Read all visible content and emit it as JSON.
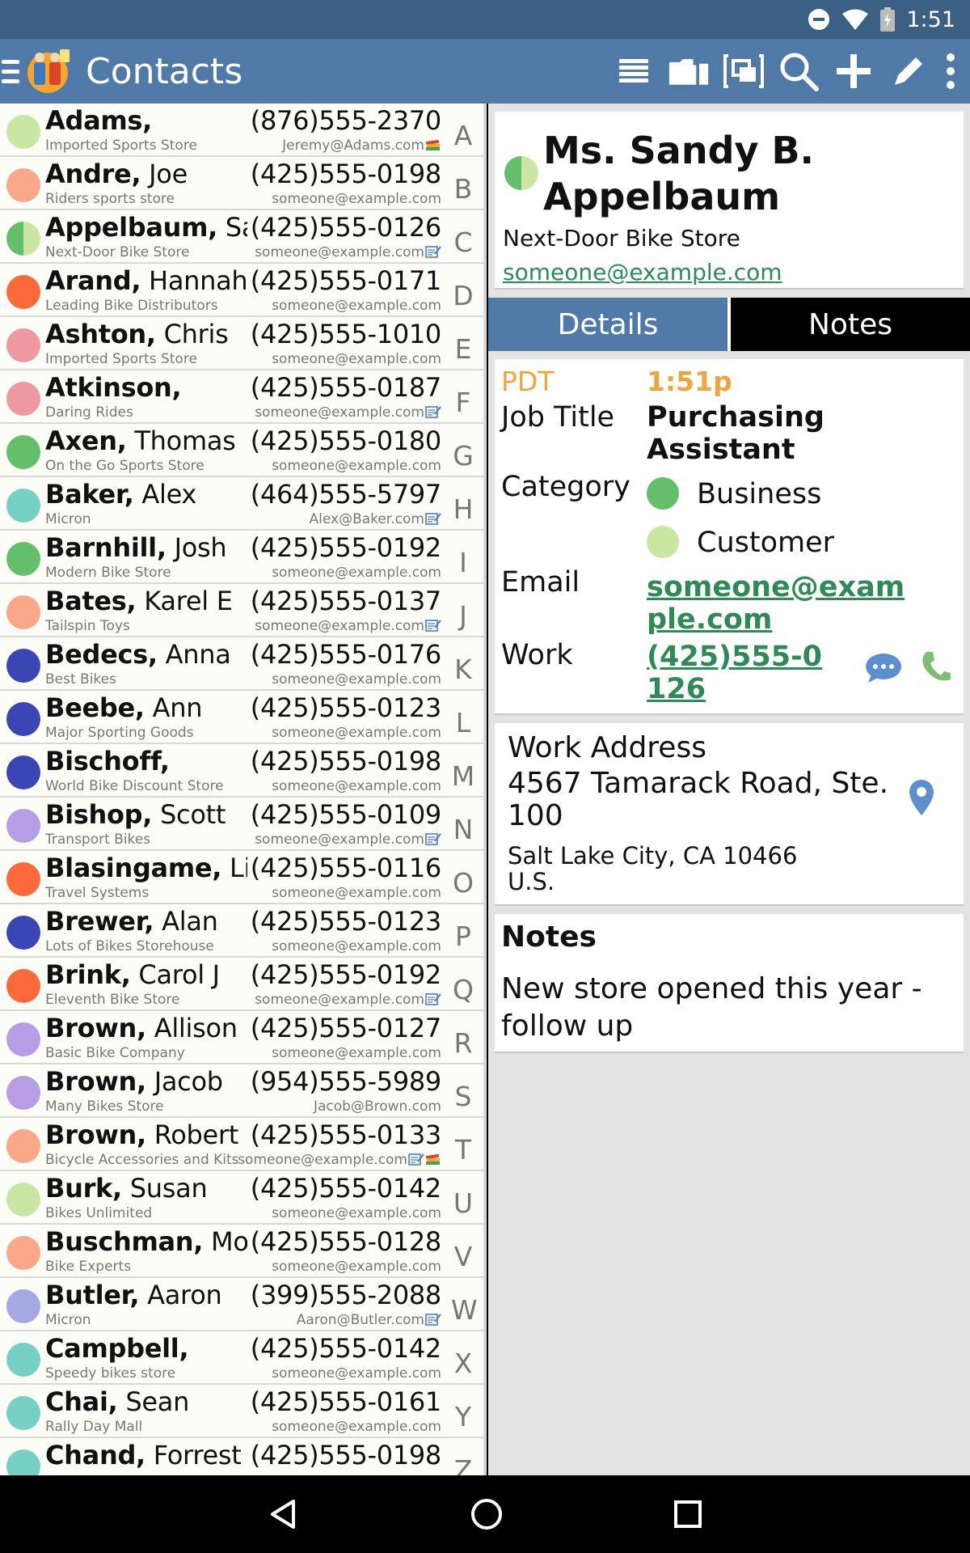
{
  "status": {
    "time": "1:51"
  },
  "app": {
    "title": "Contacts"
  },
  "contacts": [
    {
      "last": "Adams,",
      "first": "",
      "phone": "(876)555-2370",
      "company": "Imported Sports Store",
      "email": "Jeremy@Adams.com",
      "color": "#c9e6a3",
      "icons": [
        "books"
      ],
      "letter": "A"
    },
    {
      "last": "Andre,",
      "first": " Joe",
      "phone": "(425)555-0198",
      "company": "Riders sports store",
      "email": "someone@example.com",
      "color": "#f9a88a",
      "icons": [],
      "letter": "B"
    },
    {
      "last": "Appelbaum,",
      "first": " Sa",
      "phone": "(425)555-0126",
      "company": "Next-Door Bike Store",
      "email": "someone@example.com",
      "color": "split",
      "icons": [
        "note"
      ],
      "letter": "C"
    },
    {
      "last": "Arand,",
      "first": " Hannah",
      "phone": "(425)555-0171",
      "company": "Leading Bike Distributors",
      "email": "someone@example.com",
      "color": "#fc6a3b",
      "icons": [],
      "letter": "D"
    },
    {
      "last": "Ashton,",
      "first": " Chris",
      "phone": "(425)555-1010",
      "company": "Imported Sports Store",
      "email": "someone@example.com",
      "color": "#ef9aa0",
      "icons": [],
      "letter": "E"
    },
    {
      "last": "Atkinson,",
      "first": "",
      "phone": "(425)555-0187",
      "company": "Daring Rides",
      "email": "someone@example.com",
      "color": "#ef9aa0",
      "icons": [
        "note"
      ],
      "letter": "F"
    },
    {
      "last": "Axen,",
      "first": " Thomas",
      "phone": "(425)555-0180",
      "company": "On the Go Sports Store",
      "email": "someone@example.com",
      "color": "#64bf6a",
      "icons": [],
      "letter": "G"
    },
    {
      "last": "Baker,",
      "first": " Alex",
      "phone": "(464)555-5797",
      "company": "Micron",
      "email": "Alex@Baker.com",
      "color": "#76d1c4",
      "icons": [
        "note"
      ],
      "letter": "H"
    },
    {
      "last": "Barnhill,",
      "first": " Josh",
      "phone": "(425)555-0192",
      "company": "Modern Bike Store",
      "email": "someone@example.com",
      "color": "#64bf6a",
      "icons": [],
      "letter": "I"
    },
    {
      "last": "Bates,",
      "first": " Karel E",
      "phone": "(425)555-0137",
      "company": "Tailspin Toys",
      "email": "someone@example.com",
      "color": "#f9a88a",
      "icons": [
        "note"
      ],
      "letter": "J"
    },
    {
      "last": "Bedecs,",
      "first": " Anna",
      "phone": "(425)555-0176",
      "company": "Best Bikes",
      "email": "someone@example.com",
      "color": "#3b46b5",
      "icons": [],
      "letter": "K"
    },
    {
      "last": "Beebe,",
      "first": " Ann",
      "phone": "(425)555-0123",
      "company": "Major Sporting Goods",
      "email": "someone@example.com",
      "color": "#3b46b5",
      "icons": [],
      "letter": "L"
    },
    {
      "last": "Bischoff,",
      "first": "",
      "phone": "(425)555-0198",
      "company": "World Bike Discount Store",
      "email": "someone@example.com",
      "color": "#3b46b5",
      "icons": [],
      "letter": "M"
    },
    {
      "last": "Bishop,",
      "first": " Scott",
      "phone": "(425)555-0109",
      "company": "Transport Bikes",
      "email": "someone@example.com",
      "color": "#b79ce6",
      "icons": [
        "note"
      ],
      "letter": "N"
    },
    {
      "last": "Blasingame,",
      "first": " Lin",
      "phone": "(425)555-0116",
      "company": "Travel Systems",
      "email": "someone@example.com",
      "color": "#fc6a3b",
      "icons": [],
      "letter": "O"
    },
    {
      "last": "Brewer,",
      "first": " Alan",
      "phone": "(425)555-0123",
      "company": "Lots of Bikes Storehouse",
      "email": "someone@example.com",
      "color": "#3b46b5",
      "icons": [],
      "letter": "P"
    },
    {
      "last": "Brink,",
      "first": " Carol J",
      "phone": "(425)555-0192",
      "company": "Eleventh Bike Store",
      "email": "someone@example.com",
      "color": "#fc6a3b",
      "icons": [
        "note"
      ],
      "letter": "Q"
    },
    {
      "last": "Brown,",
      "first": " Allison",
      "phone": "(425)555-0127",
      "company": "Basic Bike Company",
      "email": "someone@example.com",
      "color": "#b79ce6",
      "icons": [],
      "letter": "R"
    },
    {
      "last": "Brown,",
      "first": " Jacob",
      "phone": "(954)555-5989",
      "company": "Many Bikes Store",
      "email": "Jacob@Brown.com",
      "color": "#b79ce6",
      "icons": [],
      "letter": "S"
    },
    {
      "last": "Brown,",
      "first": " Robert",
      "phone": "(425)555-0133",
      "company": "Bicycle Accessories and Kits",
      "email": "someone@example.com",
      "color": "#f9a88a",
      "icons": [
        "note",
        "books"
      ],
      "letter": "T"
    },
    {
      "last": "Burk,",
      "first": " Susan",
      "phone": "(425)555-0142",
      "company": "Bikes Unlimited",
      "email": "someone@example.com",
      "color": "#c9e6a3",
      "icons": [],
      "letter": "U"
    },
    {
      "last": "Buschman,",
      "first": " Mo",
      "phone": "(425)555-0128",
      "company": "Bike Experts",
      "email": "someone@example.com",
      "color": "#f9a88a",
      "icons": [],
      "letter": "V"
    },
    {
      "last": "Butler,",
      "first": " Aaron",
      "phone": "(399)555-2088",
      "company": "Micron",
      "email": "Aaron@Butler.com",
      "color": "#a5a9e3",
      "icons": [
        "note"
      ],
      "letter": "W"
    },
    {
      "last": "Campbell,",
      "first": "",
      "phone": "(425)555-0142",
      "company": "Speedy bikes store",
      "email": "someone@example.com",
      "color": "#76d1c4",
      "icons": [],
      "letter": "X"
    },
    {
      "last": "Chai,",
      "first": " Sean",
      "phone": "(425)555-0161",
      "company": "Rally Day Mall",
      "email": "someone@example.com",
      "color": "#76d1c4",
      "icons": [],
      "letter": "Y"
    },
    {
      "last": "Chand,",
      "first": " Forrest",
      "phone": "(425)555-0198",
      "company": "",
      "email": "",
      "color": "#76d1c4",
      "icons": [],
      "letter": "Z"
    }
  ],
  "detail": {
    "full_name": "Ms. Sandy B. Appelbaum",
    "company": "Next-Door Bike Store",
    "email": "someone@example.com",
    "tabs": {
      "details": "Details",
      "notes": "Notes"
    },
    "tz_label": "PDT",
    "tz_time": "1:51p",
    "job_title_label": "Job Title",
    "job_title": "Purchasing Assistant",
    "category_label": "Category",
    "categories": [
      {
        "name": "Business",
        "color": "#64bf6a"
      },
      {
        "name": "Customer",
        "color": "#c9e6a3"
      }
    ],
    "email_label": "Email",
    "email_value": "someone@example.com",
    "work_label": "Work",
    "work_phone": "(425)555-0126",
    "address_label": "Work Address",
    "address_street": "4567 Tamarack Road, Ste. 100",
    "address_city": "Salt Lake City, CA 10466",
    "address_country": "U.S.",
    "notes_label": "Notes",
    "notes_text": "New store opened this year - follow up"
  }
}
